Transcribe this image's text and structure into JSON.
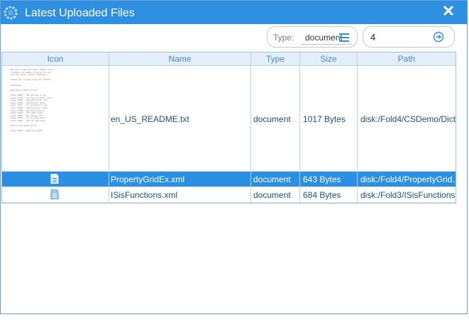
{
  "dialog": {
    "title": "Latest Uploaded Files",
    "close_icon": "close-icon"
  },
  "filters": {
    "type_label": "Type:",
    "type_value": "document",
    "count_value": "4"
  },
  "table": {
    "headers": [
      "Icon",
      "Name",
      "Type",
      "Size",
      "Path"
    ],
    "rows": [
      {
        "icon": "document-thumbnail",
        "name": "en_US_README.txt",
        "type": "document",
        "size": "1017 Bytes",
        "path": "disk:/Fold4/CSDemo/Dicti..."
      },
      {
        "icon": "xml-file-icon",
        "name": "PropertyGridEx.xml",
        "type": "document",
        "size": "643 Bytes",
        "path": "disk:/Fold4/PropertyGrid..."
      },
      {
        "icon": "xml-file-icon",
        "name": "ISisFunctions.xml",
        "type": "document",
        "size": "684 Bytes",
        "path": "disk:/Fold3/ISisFunctions..."
      }
    ],
    "selected_row": 1
  },
  "colors": {
    "titlebar": "#2f8fe0",
    "selection": "#2b90e4",
    "header_bg": "#e3eef9"
  }
}
